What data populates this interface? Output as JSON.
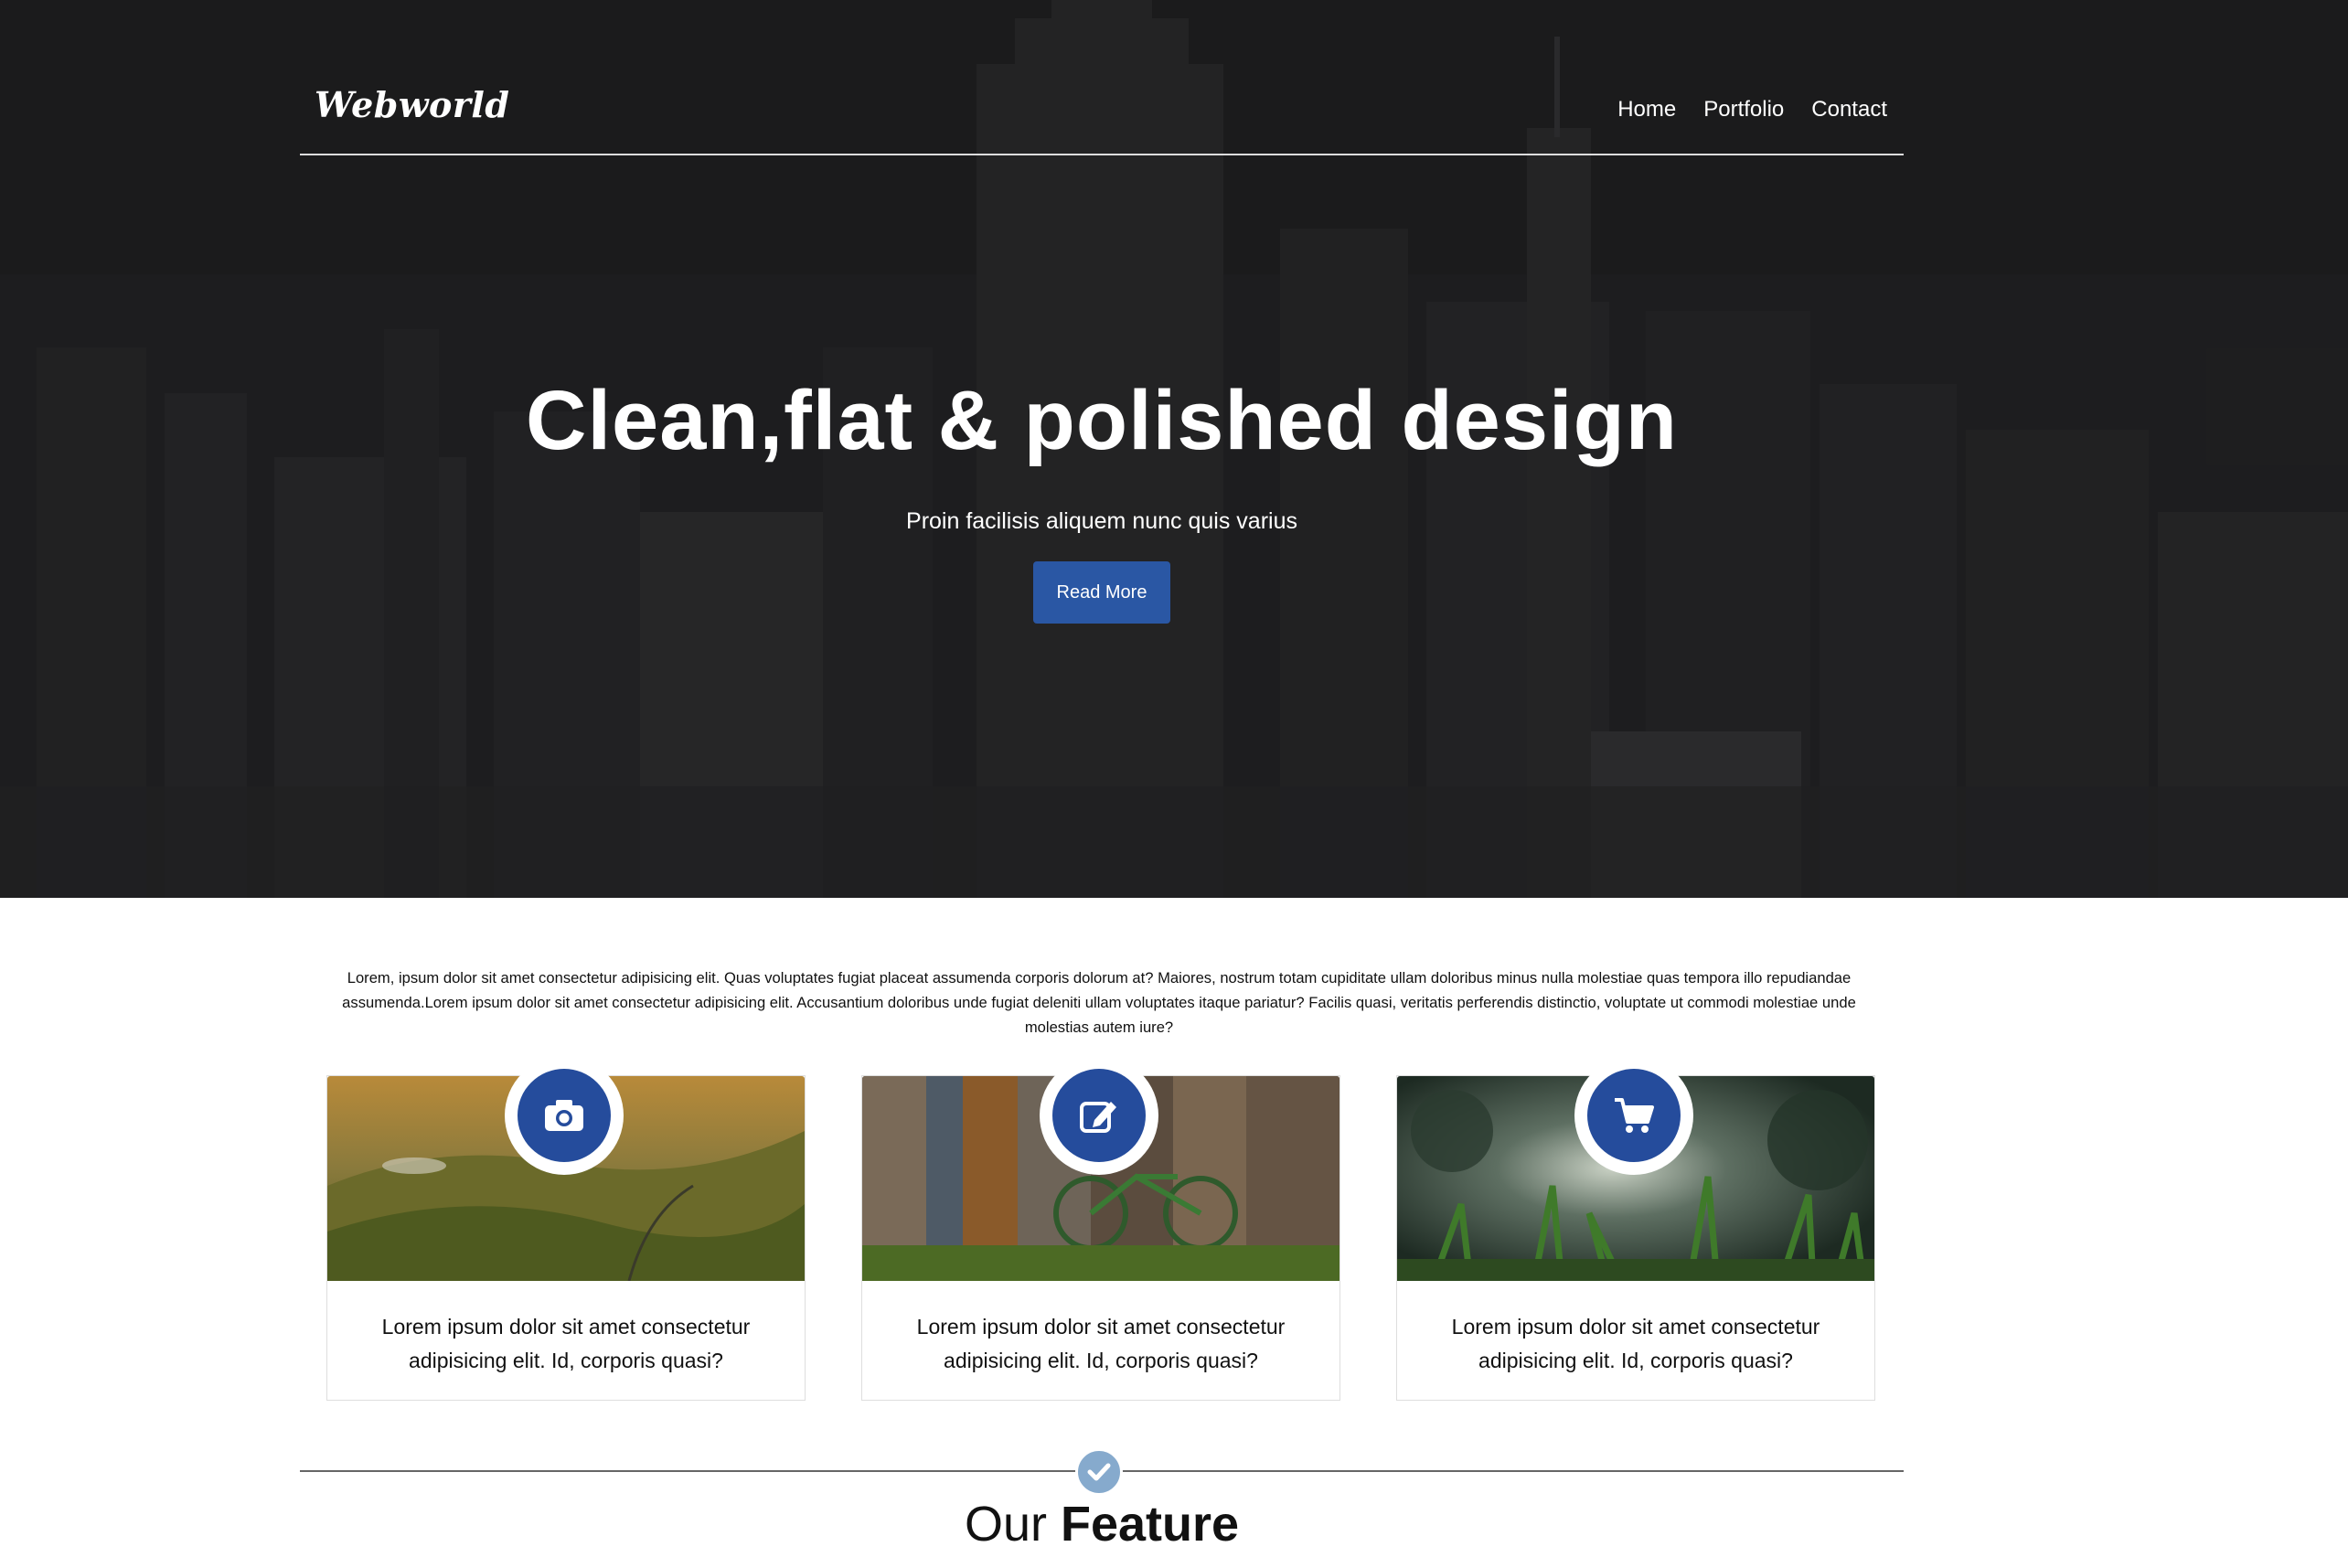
{
  "brand": {
    "logo_text": "Webworld"
  },
  "nav": {
    "items": [
      "Home",
      "Portfolio",
      "Contact"
    ]
  },
  "hero": {
    "title": "Clean,flat & polished design",
    "subtitle": "Proin facilisis aliquem nunc quis varius",
    "cta_label": "Read More"
  },
  "intro": {
    "text": "Lorem, ipsum dolor sit amet consectetur adipisicing elit. Quas voluptates fugiat placeat assumenda corporis dolorum at? Maiores, nostrum totam cupiditate ullam doloribus minus nulla molestiae quas tempora illo repudiandae assumenda.Lorem ipsum dolor sit amet consectetur adipisicing elit. Accusantium doloribus unde fugiat deleniti ullam voluptates itaque pariatur? Facilis quasi, veritatis perferendis distinctio, voluptate ut commodi molestiae unde molestias autem iure?"
  },
  "cards": [
    {
      "icon": "camera-icon",
      "caption": "Lorem ipsum dolor sit amet consectetur adipisicing elit. Id, corporis quasi?"
    },
    {
      "icon": "edit-icon",
      "caption": "Lorem ipsum dolor sit amet consectetur adipisicing elit. Id, corporis quasi?"
    },
    {
      "icon": "cart-icon",
      "caption": "Lorem ipsum dolor sit amet consectetur adipisicing elit. Id, corporis quasi?"
    }
  ],
  "feature": {
    "title_light": "Our ",
    "title_bold": "Feature",
    "icon": "check-circle-icon"
  },
  "colors": {
    "accent": "#2a57a4",
    "badge": "#254c9c",
    "check": "#86aacd",
    "hero_bg": "#1e1e1f"
  }
}
